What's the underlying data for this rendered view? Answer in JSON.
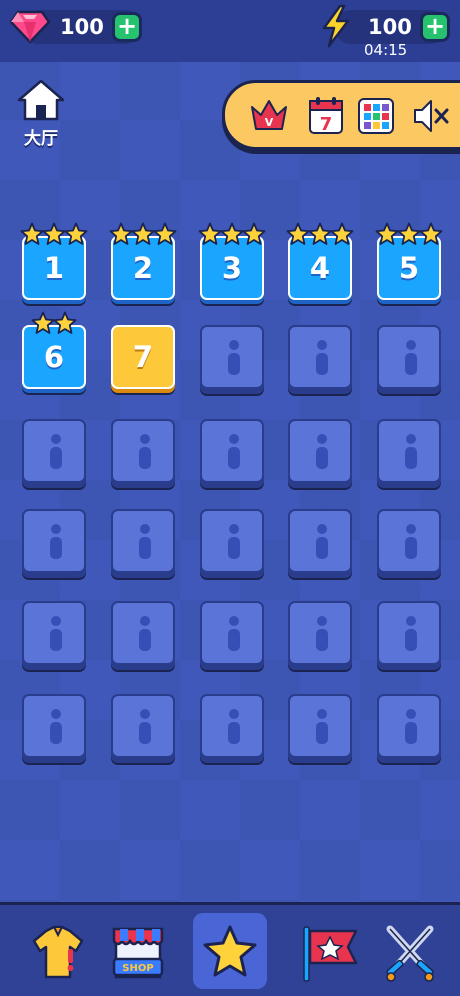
{
  "header": {
    "gems": "100",
    "energy": "100",
    "timer": "04:15"
  },
  "home": {
    "label": "大厅"
  },
  "panel": {
    "calendar_day": "7",
    "vip_label": "V"
  },
  "levels": [
    {
      "number": "1",
      "state": "completed",
      "stars": 3
    },
    {
      "number": "2",
      "state": "completed",
      "stars": 3
    },
    {
      "number": "3",
      "state": "completed",
      "stars": 3
    },
    {
      "number": "4",
      "state": "completed",
      "stars": 3
    },
    {
      "number": "5",
      "state": "completed",
      "stars": 3
    },
    {
      "number": "6",
      "state": "completed",
      "stars": 2
    },
    {
      "number": "7",
      "state": "current",
      "stars": 0
    }
  ],
  "locked_count": 23,
  "bottom_nav": {
    "shop_label": "SHOP",
    "items": [
      "shirt-icon",
      "shop-icon",
      "star-icon",
      "flag-icon",
      "swords-icon"
    ],
    "selected": "star-icon"
  },
  "colors": {
    "background": "#3e56b8",
    "level_blue": "#1aa6ff",
    "level_current": "#fdc93a",
    "locked": "#5a74d8",
    "plus_green": "#27c26e",
    "panel": "#fcc862"
  }
}
